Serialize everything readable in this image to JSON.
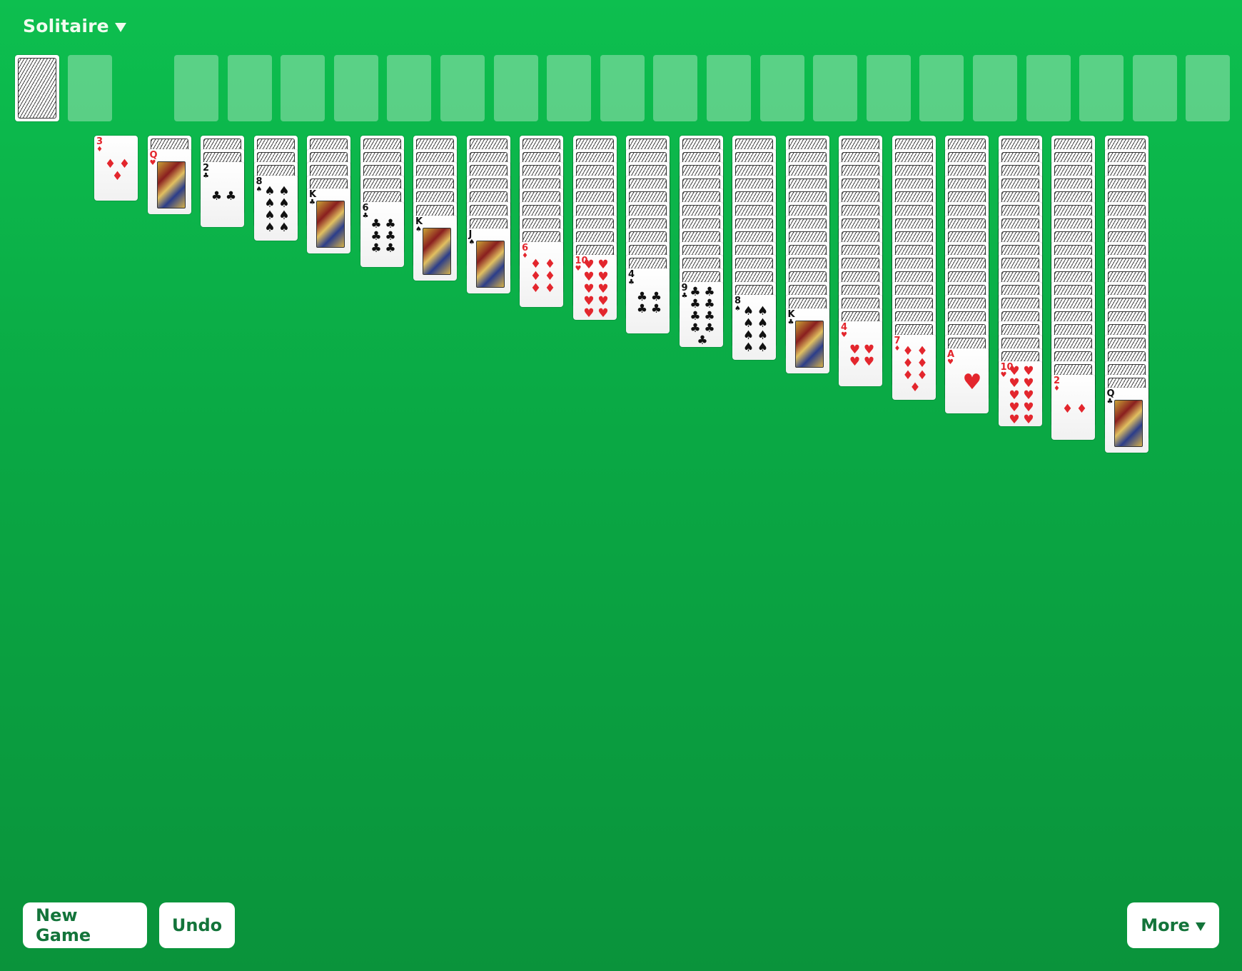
{
  "header": {
    "title": "Solitaire",
    "title_menu_icon": "caret-down-icon"
  },
  "colors": {
    "table_top": "#0dbf4f",
    "table_bottom": "#0a933b",
    "button_text": "#13743a",
    "red_suit": "#e3262d",
    "black_suit": "#111111"
  },
  "stock": {
    "face_down": true
  },
  "waste": {
    "empty": true
  },
  "foundations": {
    "count": 20
  },
  "tableau": [
    {
      "rank": "3",
      "suit": "♦",
      "color": "red",
      "face_down": 0
    },
    {
      "rank": "Q",
      "suit": "♥",
      "color": "red",
      "face_down": 1
    },
    {
      "rank": "2",
      "suit": "♣",
      "color": "black",
      "face_down": 2
    },
    {
      "rank": "8",
      "suit": "♠",
      "color": "black",
      "face_down": 3
    },
    {
      "rank": "K",
      "suit": "♣",
      "color": "black",
      "face_down": 4
    },
    {
      "rank": "6",
      "suit": "♣",
      "color": "black",
      "face_down": 5
    },
    {
      "rank": "K",
      "suit": "♠",
      "color": "black",
      "face_down": 6
    },
    {
      "rank": "J",
      "suit": "♠",
      "color": "black",
      "face_down": 7
    },
    {
      "rank": "6",
      "suit": "♦",
      "color": "red",
      "face_down": 8
    },
    {
      "rank": "10",
      "suit": "♥",
      "color": "red",
      "face_down": 9
    },
    {
      "rank": "4",
      "suit": "♣",
      "color": "black",
      "face_down": 10
    },
    {
      "rank": "9",
      "suit": "♣",
      "color": "black",
      "face_down": 11
    },
    {
      "rank": "8",
      "suit": "♠",
      "color": "black",
      "face_down": 12
    },
    {
      "rank": "K",
      "suit": "♣",
      "color": "black",
      "face_down": 13
    },
    {
      "rank": "4",
      "suit": "♥",
      "color": "red",
      "face_down": 14
    },
    {
      "rank": "7",
      "suit": "♦",
      "color": "red",
      "face_down": 15
    },
    {
      "rank": "A",
      "suit": "♥",
      "color": "red",
      "face_down": 16
    },
    {
      "rank": "10",
      "suit": "♥",
      "color": "red",
      "face_down": 17
    },
    {
      "rank": "2",
      "suit": "♦",
      "color": "red",
      "face_down": 18
    },
    {
      "rank": "Q",
      "suit": "♣",
      "color": "black",
      "face_down": 19
    }
  ],
  "footer": {
    "new_game_label": "New Game",
    "undo_label": "Undo",
    "more_label": "More",
    "more_icon": "caret-down-icon"
  }
}
